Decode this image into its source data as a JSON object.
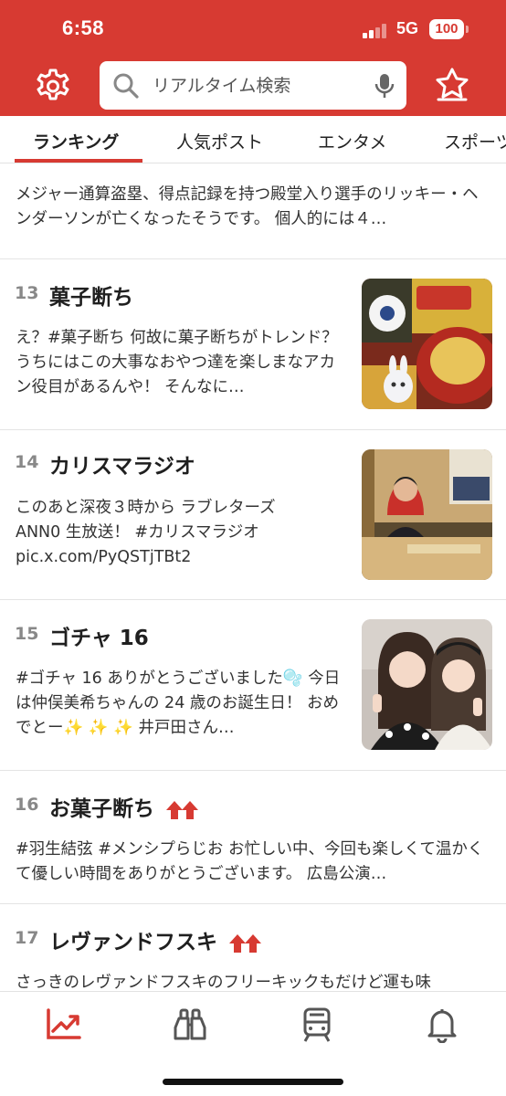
{
  "status_bar": {
    "time": "6:58",
    "network": "5G",
    "battery": "100"
  },
  "header": {
    "settings_icon": "gear-icon",
    "search": {
      "placeholder": "リアルタイム検索",
      "icon": "search-icon",
      "mic_icon": "microphone-icon"
    },
    "favorites_icon": "star-icon"
  },
  "tabs": [
    {
      "label": "ランキング",
      "active": true
    },
    {
      "label": "人気ポスト",
      "active": false
    },
    {
      "label": "エンタメ",
      "active": false
    },
    {
      "label": "スポーツ",
      "active": false
    }
  ],
  "accent_color": "#d73a32",
  "items": [
    {
      "rank": "",
      "title": "",
      "snippet": "メジャー通算盗塁、得点記録を持つ殿堂入り選手のリッキー・ヘンダーソンが亡くなったそうです。 個人的には４…"
    },
    {
      "rank": "13",
      "title": "菓子断ち",
      "snippet": "え？#菓子断ち 何故に菓子断ちがトレンド？ うちにはこの大事なおやつ達を楽しまなアカン役目があるんや！ そんなに…",
      "has_image": true
    },
    {
      "rank": "14",
      "title": "カリスマラジオ",
      "snippet": "このあと深夜３時から ラブレターズ ANN0 生放送！ #カリスマラジオ pic.x.com/PyQSTjTBt2",
      "has_image": true
    },
    {
      "rank": "15",
      "title": "ゴチャ 16",
      "snippet": "#ゴチャ 16 ありがとうございました🫧 今日は仲俣美希ちゃんの 24 歳のお誕生日！ おめでとー✨ ✨ ✨ 井戸田さん…",
      "has_image": true
    },
    {
      "rank": "16",
      "title": "お菓子断ち",
      "snippet": "#羽生結弦 #メンシプらじお お忙しい中、今回も楽しくて温かくて優しい時間をありがとうございます。 広島公演…",
      "trend_icon": "double-up-arrow-icon"
    },
    {
      "rank": "17",
      "title": "レヴァンドフスキ",
      "snippet": "さっきのレヴァンドフスキのフリーキックもだけど運も味",
      "trend_icon": "double-up-arrow-icon"
    }
  ],
  "bottom_nav": [
    {
      "icon": "trend-chart-icon",
      "active": true
    },
    {
      "icon": "binoculars-icon",
      "active": false
    },
    {
      "icon": "train-icon",
      "active": false
    },
    {
      "icon": "bell-icon",
      "active": false
    }
  ]
}
